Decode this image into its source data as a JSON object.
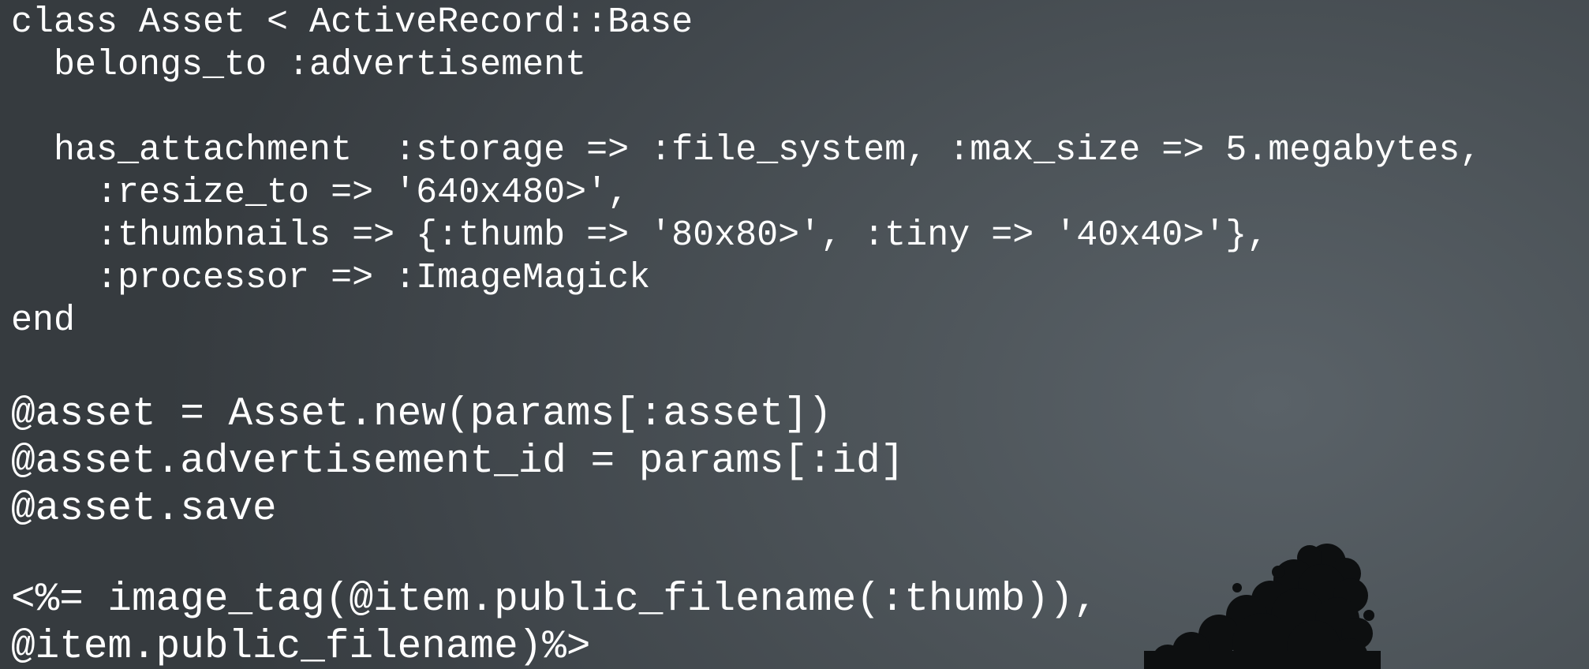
{
  "model_block": {
    "lines": [
      "class Asset < ActiveRecord::Base",
      "  belongs_to :advertisement",
      "",
      "  has_attachment  :storage => :file_system, :max_size => 5.megabytes,",
      "    :resize_to => '640x480>',",
      "    :thumbnails => {:thumb => '80x80>', :tiny => '40x40>'},",
      "    :processor => :ImageMagick",
      "end"
    ]
  },
  "controller_block": {
    "lines": [
      "@asset = Asset.new(params[:asset])",
      "@asset.advertisement_id = params[:id]",
      "@asset.save"
    ]
  },
  "view_block": {
    "lines": [
      "<%= image_tag(@item.public_filename(:thumb)),",
      "@item.public_filename)%>"
    ]
  },
  "colors": {
    "text": "#ffffff",
    "background": "#4c5358",
    "tree": "#0d0f10"
  }
}
